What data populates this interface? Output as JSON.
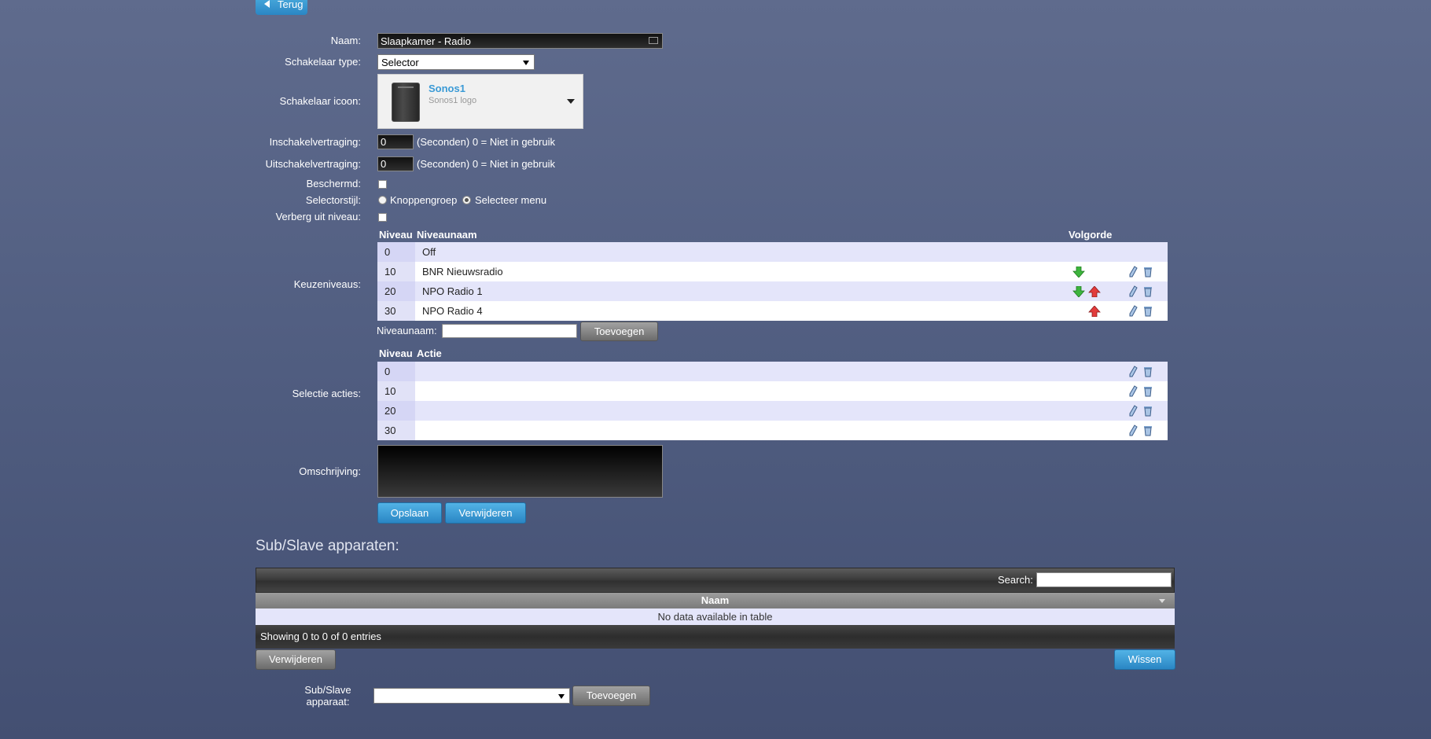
{
  "header": {
    "back_label": "Terug"
  },
  "form": {
    "name_label": "Naam:",
    "name_value": "Slaapkamer - Radio",
    "switch_type_label": "Schakelaar type:",
    "switch_type_value": "Selector",
    "switch_icon_label": "Schakelaar icoon:",
    "icon_title": "Sonos1",
    "icon_subtitle": "Sonos1 logo",
    "on_delay_label": "Inschakelvertraging:",
    "on_delay_value": "0",
    "off_delay_label": "Uitschakelvertraging:",
    "off_delay_value": "0",
    "delay_hint": "(Seconden) 0 = Niet in gebruik",
    "protected_label": "Beschermd:",
    "selector_style_label": "Selectorstijl:",
    "style_option_buttons": "Knoppengroep",
    "style_option_menu": "Selecteer menu",
    "hide_off_label": "Verberg uit niveau:",
    "levels_label": "Keuzeniveaus:",
    "levels_header": {
      "level": "Niveau",
      "name": "Niveaunaam",
      "order": "Volgorde"
    },
    "levels": [
      {
        "level": "0",
        "name": "Off"
      },
      {
        "level": "10",
        "name": "BNR Nieuwsradio"
      },
      {
        "level": "20",
        "name": "NPO Radio 1"
      },
      {
        "level": "30",
        "name": "NPO Radio 4"
      }
    ],
    "level_name_label": "Niveaunaam:",
    "add_label": "Toevoegen",
    "actions_label": "Selectie acties:",
    "actions_header": {
      "level": "Niveau",
      "action": "Actie"
    },
    "actions": [
      {
        "level": "0",
        "action": ""
      },
      {
        "level": "10",
        "action": ""
      },
      {
        "level": "20",
        "action": ""
      },
      {
        "level": "30",
        "action": ""
      }
    ],
    "description_label": "Omschrijving:",
    "save_label": "Opslaan",
    "delete_label": "Verwijderen"
  },
  "sub_slave": {
    "title": "Sub/Slave apparaten:",
    "search_label": "Search:",
    "column_name": "Naam",
    "empty_text": "No data available in table",
    "info_text": "Showing 0 to 0 of 0 entries",
    "delete_label": "Verwijderen",
    "clear_label": "Wissen",
    "device_label_line1": "Sub/Slave",
    "device_label_line2": "apparaat:",
    "add_label": "Toevoegen"
  },
  "icons": {
    "down": "arrow-down-icon",
    "up": "arrow-up-icon",
    "edit": "pencil-icon",
    "delete": "trash-icon"
  },
  "colors": {
    "accent_blue": "#2a86c4",
    "arrow_down": "#3db43d",
    "arrow_up": "#e23b3b"
  }
}
